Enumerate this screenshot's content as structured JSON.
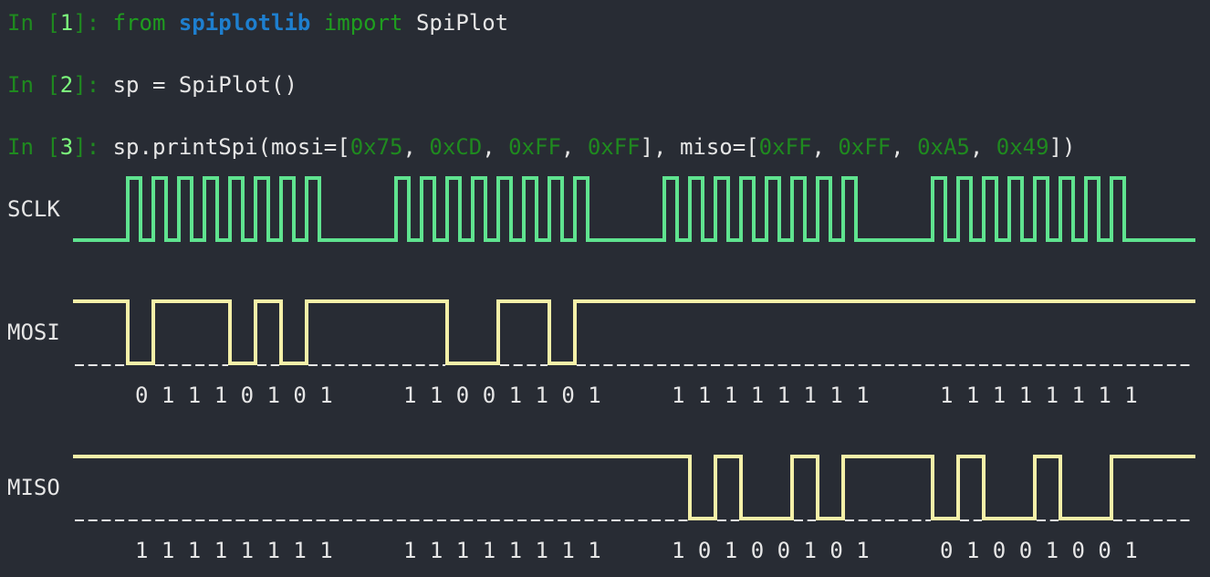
{
  "colors": {
    "background": "#282c34",
    "prompt": "#1f8a1f",
    "prompt_number": "#7dff7d",
    "keyword": "#1f9e1f",
    "module": "#1e7fcf",
    "literal": "#1f8a1f",
    "text": "#e6e6e6",
    "sclk_wave": "#5fe38f",
    "data_wave": "#f5f0a8",
    "dashes": "#e6e6e6"
  },
  "cells": [
    {
      "prompt_in": "In [",
      "prompt_num": "1",
      "prompt_out": "]: ",
      "tokens": [
        {
          "text": "from",
          "kind": "kw"
        },
        {
          "text": " ",
          "kind": "plain"
        },
        {
          "text": "spiplotlib",
          "kind": "mod"
        },
        {
          "text": " ",
          "kind": "plain"
        },
        {
          "text": "import",
          "kind": "kw"
        },
        {
          "text": " SpiPlot",
          "kind": "plain"
        }
      ]
    },
    {
      "prompt_in": "In [",
      "prompt_num": "2",
      "prompt_out": "]: ",
      "tokens": [
        {
          "text": "sp = SpiPlot()",
          "kind": "plain"
        }
      ]
    },
    {
      "prompt_in": "In [",
      "prompt_num": "3",
      "prompt_out": "]: ",
      "tokens": [
        {
          "text": "sp.printSpi(mosi=[",
          "kind": "plain"
        },
        {
          "text": "0x75",
          "kind": "num"
        },
        {
          "text": ", ",
          "kind": "plain"
        },
        {
          "text": "0xCD",
          "kind": "num"
        },
        {
          "text": ", ",
          "kind": "plain"
        },
        {
          "text": "0xFF",
          "kind": "num"
        },
        {
          "text": ", ",
          "kind": "plain"
        },
        {
          "text": "0xFF",
          "kind": "num"
        },
        {
          "text": "], miso=[",
          "kind": "plain"
        },
        {
          "text": "0xFF",
          "kind": "num"
        },
        {
          "text": ", ",
          "kind": "plain"
        },
        {
          "text": "0xFF",
          "kind": "num"
        },
        {
          "text": ", ",
          "kind": "plain"
        },
        {
          "text": "0xA5",
          "kind": "num"
        },
        {
          "text": ", ",
          "kind": "plain"
        },
        {
          "text": "0x49",
          "kind": "num"
        },
        {
          "text": "])",
          "kind": "plain"
        }
      ]
    }
  ],
  "signals": {
    "sclk": {
      "label": "SCLK"
    },
    "mosi": {
      "label": "MOSI",
      "bytes": [
        "0 1 1 1 0 1 0 1",
        "1 1 0 0 1 1 0 1",
        "1 1 1 1 1 1 1 1",
        "1 1 1 1 1 1 1 1"
      ]
    },
    "miso": {
      "label": "MISO",
      "bytes": [
        "1 1 1 1 1 1 1 1",
        "1 1 1 1 1 1 1 1",
        "1 0 1 0 0 1 0 1",
        "0 1 0 0 1 0 0 1"
      ]
    }
  }
}
